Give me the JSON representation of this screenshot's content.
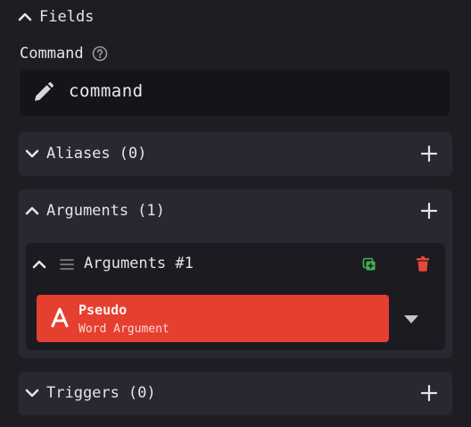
{
  "fields": {
    "title": "Fields"
  },
  "command": {
    "label": "Command",
    "value": "command"
  },
  "aliases": {
    "label": "Aliases",
    "count": "(0)"
  },
  "arguments": {
    "label": "Arguments",
    "count": "(1)",
    "items": [
      {
        "title": "Arguments #1",
        "name": "Pseudo",
        "type": "Word Argument"
      }
    ]
  },
  "triggers": {
    "label": "Triggers",
    "count": "(0)"
  },
  "colors": {
    "background": "#1f1d24",
    "section": "#29272f",
    "input": "#151419",
    "argument": "#e53f30",
    "duplicate": "#3fb34f",
    "delete": "#e8483a"
  },
  "icons": [
    "chevron-up-icon",
    "chevron-down-icon",
    "help-icon",
    "pencil-icon",
    "plus-icon",
    "drag-handle-icon",
    "duplicate-icon",
    "trash-icon",
    "letter-a-icon",
    "caret-down-icon"
  ]
}
